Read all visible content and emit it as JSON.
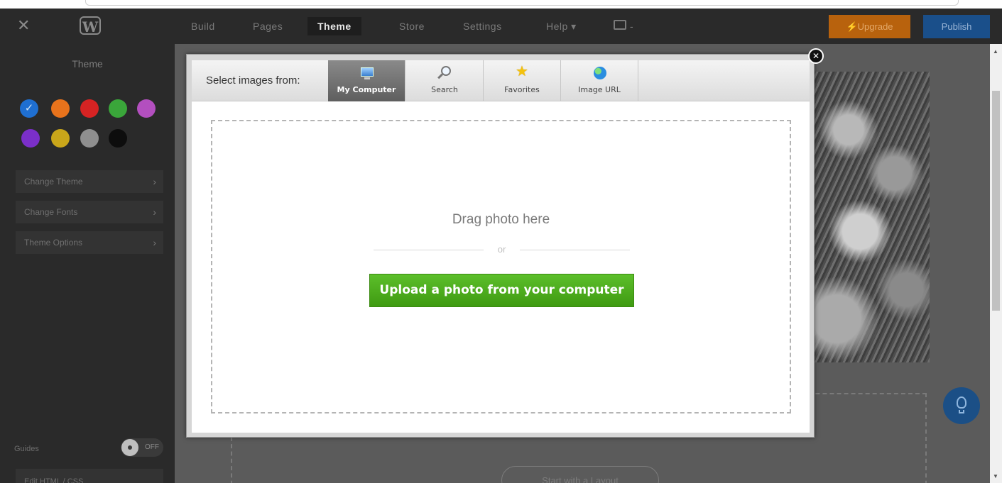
{
  "topbar": {
    "nav": [
      "Build",
      "Pages",
      "Theme",
      "Store",
      "Settings",
      "Help ▾"
    ],
    "active_nav": "Theme",
    "upgrade_label": "⚡Upgrade",
    "publish_label": "Publish"
  },
  "sidebar": {
    "title": "Theme",
    "swatches": [
      "#1f6fd1",
      "#e8731c",
      "#d62323",
      "#3aa63a",
      "#b34fbf",
      "#7b2fc9",
      "#c9a61a",
      "#8f8f8f",
      "#0d0d0d"
    ],
    "selected_swatch": "#1f6fd1",
    "rows": [
      "Change Theme",
      "Change Fonts",
      "Theme Options"
    ],
    "guides_label": "Guides",
    "guides_state": "OFF",
    "edit_html": "Edit HTML / CSS"
  },
  "canvas": {
    "layout_button": "Start with a Layout"
  },
  "modal": {
    "select_label": "Select images from:",
    "tabs": [
      "My Computer",
      "Search",
      "Favorites",
      "Image URL"
    ],
    "active_tab": "My Computer",
    "drag_text": "Drag photo here",
    "or_text": "or",
    "upload_button": "Upload a photo from your computer",
    "close_symbol": "✕"
  },
  "colors": {
    "upgrade": "#b8620d",
    "publish": "#1a4f8a",
    "upload_green": "#4caf1e"
  }
}
